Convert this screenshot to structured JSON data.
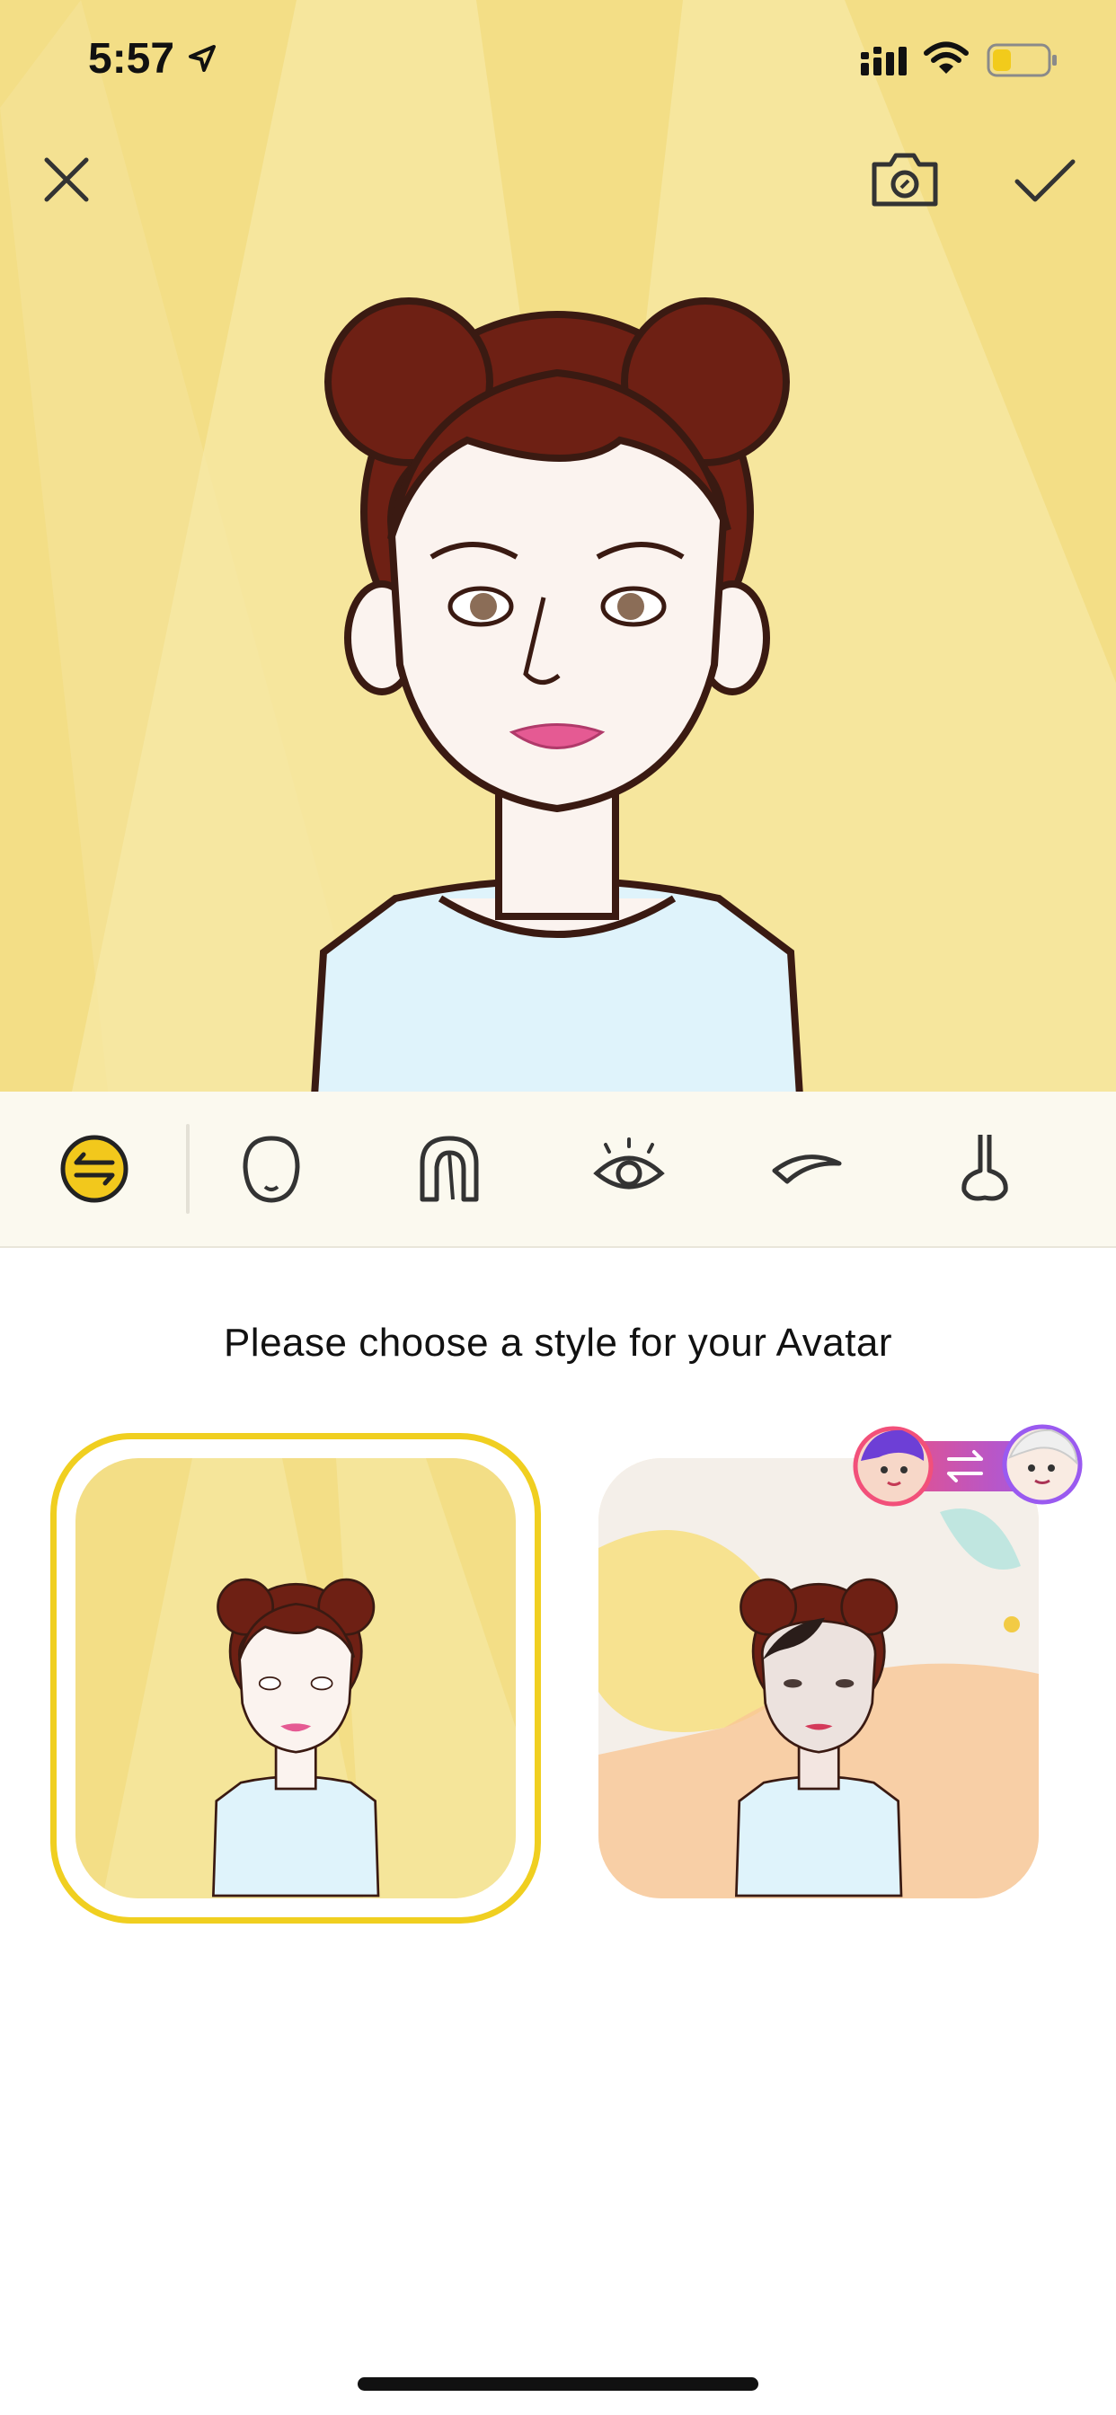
{
  "status_bar": {
    "time": "5:57"
  },
  "top_bar": {
    "close_icon": "close-icon",
    "camera_icon": "camera-icon",
    "confirm_icon": "checkmark-icon"
  },
  "toolbar": {
    "items": [
      {
        "name": "swap-style",
        "icon": "swap-arrows-icon",
        "selected": true
      },
      {
        "name": "face-shape",
        "icon": "face-outline-icon"
      },
      {
        "name": "hair",
        "icon": "hair-icon"
      },
      {
        "name": "eyes",
        "icon": "eye-icon"
      },
      {
        "name": "eyebrows",
        "icon": "eyebrow-icon"
      },
      {
        "name": "nose",
        "icon": "nose-icon"
      }
    ]
  },
  "style_picker": {
    "title": "Please choose a style for your Avatar",
    "options": [
      {
        "name": "cartoon-style",
        "selected": true
      },
      {
        "name": "photo-style",
        "selected": false,
        "badge_icon": "face-swap-badge-icon"
      }
    ]
  },
  "colors": {
    "stage_background": "#f3de86",
    "accent_yellow": "#f0cf20",
    "hair": "#6e2014",
    "shirt": "#dff3fb"
  }
}
